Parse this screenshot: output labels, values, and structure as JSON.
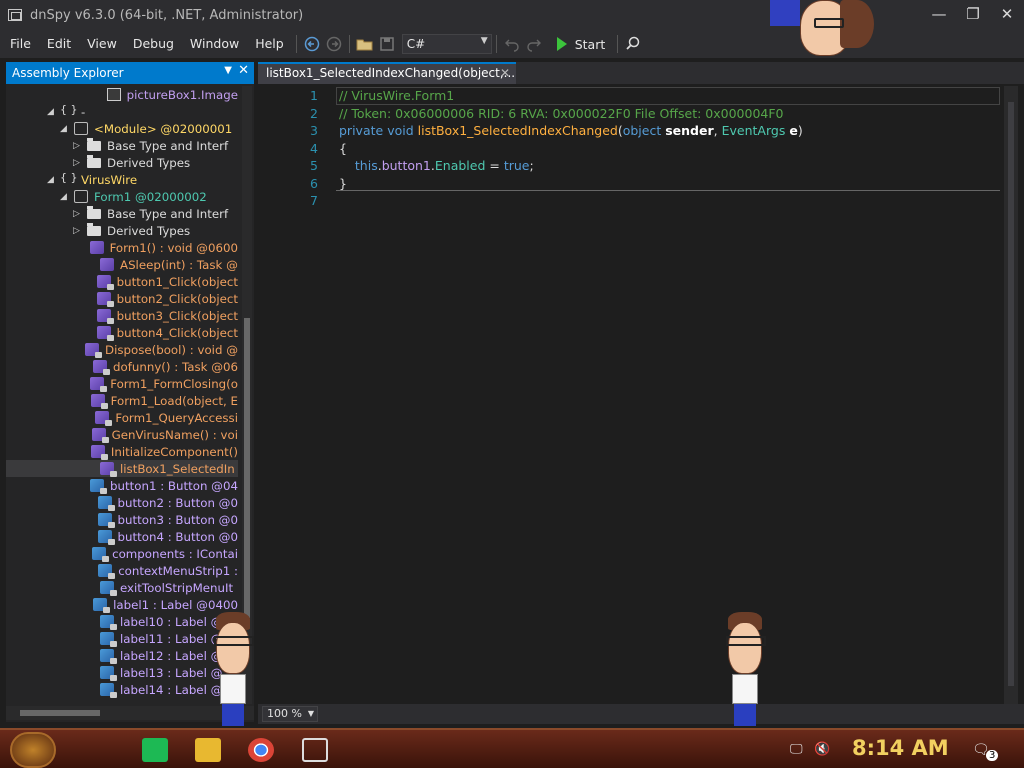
{
  "window": {
    "title": "dnSpy v6.3.0 (64-bit, .NET, Administrator)",
    "minimize_glyph": "—",
    "maximize_glyph": "❐",
    "close_glyph": "✕"
  },
  "menu": {
    "items": [
      "File",
      "Edit",
      "View",
      "Debug",
      "Window",
      "Help"
    ]
  },
  "toolbar": {
    "language": "C#",
    "start_label": "Start",
    "icons": [
      "back-icon",
      "forward-icon",
      "open-icon",
      "save-icon",
      "undo-icon",
      "redo-icon",
      "search-icon"
    ]
  },
  "explorer": {
    "title": "Assembly Explorer",
    "pin_glyph": "▼",
    "close_glyph": "✕",
    "rows": [
      {
        "indent": 7,
        "twisty": "",
        "icon": "img",
        "text": "pictureBox1.Image",
        "cls": "n-purple"
      },
      {
        "indent": 3,
        "twisty": "◢",
        "icon": "ns",
        "text": "-",
        "cls": "n-white"
      },
      {
        "indent": 4,
        "twisty": "◢",
        "icon": "module",
        "text": "<Module> @02000001",
        "cls": "n-yellow"
      },
      {
        "indent": 5,
        "twisty": "▷",
        "icon": "folder",
        "text": "Base Type and Interf",
        "cls": "n-white"
      },
      {
        "indent": 5,
        "twisty": "▷",
        "icon": "folder",
        "text": "Derived Types",
        "cls": "n-white"
      },
      {
        "indent": 3,
        "twisty": "◢",
        "icon": "ns",
        "text": "VirusWire",
        "cls": "n-yellow"
      },
      {
        "indent": 4,
        "twisty": "◢",
        "icon": "module",
        "text": "Form1 @02000002",
        "cls": "n-teal"
      },
      {
        "indent": 5,
        "twisty": "▷",
        "icon": "folder",
        "text": "Base Type and Interf",
        "cls": "n-white"
      },
      {
        "indent": 5,
        "twisty": "▷",
        "icon": "folder",
        "text": "Derived Types",
        "cls": "n-white"
      },
      {
        "indent": 6,
        "twisty": "",
        "icon": "cube",
        "text": "Form1() : void @0600",
        "cls": "n-method"
      },
      {
        "indent": 6,
        "twisty": "",
        "icon": "cube",
        "text": "ASleep(int) : Task @",
        "cls": "n-method"
      },
      {
        "indent": 6,
        "twisty": "",
        "icon": "cube-lock",
        "text": "button1_Click(object",
        "cls": "n-method"
      },
      {
        "indent": 6,
        "twisty": "",
        "icon": "cube-lock",
        "text": "button2_Click(object",
        "cls": "n-method"
      },
      {
        "indent": 6,
        "twisty": "",
        "icon": "cube-lock",
        "text": "button3_Click(object",
        "cls": "n-method"
      },
      {
        "indent": 6,
        "twisty": "",
        "icon": "cube-lock",
        "text": "button4_Click(object",
        "cls": "n-method"
      },
      {
        "indent": 6,
        "twisty": "",
        "icon": "cube-lock",
        "text": "Dispose(bool) : void @",
        "cls": "n-method"
      },
      {
        "indent": 6,
        "twisty": "",
        "icon": "cube-lock",
        "text": "dofunny() : Task @06",
        "cls": "n-method"
      },
      {
        "indent": 6,
        "twisty": "",
        "icon": "cube-lock",
        "text": "Form1_FormClosing(o",
        "cls": "n-method"
      },
      {
        "indent": 6,
        "twisty": "",
        "icon": "cube-lock",
        "text": "Form1_Load(object, E",
        "cls": "n-method"
      },
      {
        "indent": 6,
        "twisty": "",
        "icon": "cube-lock",
        "text": "Form1_QueryAccessi",
        "cls": "n-method"
      },
      {
        "indent": 6,
        "twisty": "",
        "icon": "cube-lock",
        "text": "GenVirusName() : voi",
        "cls": "n-method"
      },
      {
        "indent": 6,
        "twisty": "",
        "icon": "cube-lock",
        "text": "InitializeComponent()",
        "cls": "n-method"
      },
      {
        "indent": 6,
        "twisty": "",
        "icon": "cube-lock",
        "text": "listBox1_SelectedIn",
        "cls": "n-method",
        "selected": true
      },
      {
        "indent": 6,
        "twisty": "",
        "icon": "field-lock",
        "text": "button1 : Button @04",
        "cls": "n-field"
      },
      {
        "indent": 6,
        "twisty": "",
        "icon": "field-lock",
        "text": "button2 : Button @0",
        "cls": "n-field"
      },
      {
        "indent": 6,
        "twisty": "",
        "icon": "field-lock",
        "text": "button3 : Button @0",
        "cls": "n-field"
      },
      {
        "indent": 6,
        "twisty": "",
        "icon": "field-lock",
        "text": "button4 : Button @0",
        "cls": "n-field"
      },
      {
        "indent": 6,
        "twisty": "",
        "icon": "field-lock",
        "text": "components : IContai",
        "cls": "n-field"
      },
      {
        "indent": 6,
        "twisty": "",
        "icon": "field-lock",
        "text": "contextMenuStrip1 :",
        "cls": "n-field"
      },
      {
        "indent": 6,
        "twisty": "",
        "icon": "field-lock",
        "text": "exitToolStripMenuIt",
        "cls": "n-field"
      },
      {
        "indent": 6,
        "twisty": "",
        "icon": "field-lock",
        "text": "label1 : Label @0400",
        "cls": "n-field"
      },
      {
        "indent": 6,
        "twisty": "",
        "icon": "field-lock",
        "text": "label10 : Label @",
        "cls": "n-field"
      },
      {
        "indent": 6,
        "twisty": "",
        "icon": "field-lock",
        "text": "label11 : Label @",
        "cls": "n-field"
      },
      {
        "indent": 6,
        "twisty": "",
        "icon": "field-lock",
        "text": "label12 : Label @",
        "cls": "n-field"
      },
      {
        "indent": 6,
        "twisty": "",
        "icon": "field-lock",
        "text": "label13 : Label @",
        "cls": "n-field"
      },
      {
        "indent": 6,
        "twisty": "",
        "icon": "field-lock",
        "text": "label14 : Label @0",
        "cls": "n-field"
      }
    ]
  },
  "editor": {
    "tab_title": "listBox1_SelectedIndexChanged(object,...",
    "tab_close": "✕",
    "zoom": "100 %",
    "line_numbers": [
      "1",
      "2",
      "3",
      "4",
      "5",
      "6",
      "7"
    ],
    "lines": [
      [
        {
          "t": "// VirusWire.Form1",
          "c": "c-comment"
        }
      ],
      [
        {
          "t": "// Token: 0x06000006 RID: 6 RVA: 0x000022F0 File Offset: 0x000004F0",
          "c": "c-comment"
        }
      ],
      [
        {
          "t": "private",
          "c": "c-kw"
        },
        {
          "t": " ",
          "c": "c-plain"
        },
        {
          "t": "void",
          "c": "c-kw"
        },
        {
          "t": " ",
          "c": "c-plain"
        },
        {
          "t": "listBox1_SelectedIndexChanged",
          "c": "c-method"
        },
        {
          "t": "(",
          "c": "c-plain"
        },
        {
          "t": "object",
          "c": "c-kw"
        },
        {
          "t": " ",
          "c": "c-plain"
        },
        {
          "t": "sender",
          "c": "c-param"
        },
        {
          "t": ", ",
          "c": "c-plain"
        },
        {
          "t": "EventArgs",
          "c": "c-type"
        },
        {
          "t": " ",
          "c": "c-plain"
        },
        {
          "t": "e",
          "c": "c-param"
        },
        {
          "t": ")",
          "c": "c-plain"
        }
      ],
      [
        {
          "t": "{",
          "c": "c-plain"
        }
      ],
      [
        {
          "t": "    ",
          "c": "c-plain"
        },
        {
          "t": "this",
          "c": "c-kw"
        },
        {
          "t": ".",
          "c": "c-plain"
        },
        {
          "t": "button1",
          "c": "c-field"
        },
        {
          "t": ".",
          "c": "c-plain"
        },
        {
          "t": "Enabled",
          "c": "c-type"
        },
        {
          "t": " = ",
          "c": "c-plain"
        },
        {
          "t": "true",
          "c": "c-kw"
        },
        {
          "t": ";",
          "c": "c-plain"
        }
      ],
      [
        {
          "t": "}",
          "c": "c-plain"
        }
      ],
      []
    ]
  },
  "taskbar": {
    "clock": "8:14 AM",
    "notification_count": "3",
    "apps": [
      "spotify-app-icon",
      "file-explorer-app-icon",
      "chrome-app-icon",
      "task-view-icon"
    ]
  }
}
